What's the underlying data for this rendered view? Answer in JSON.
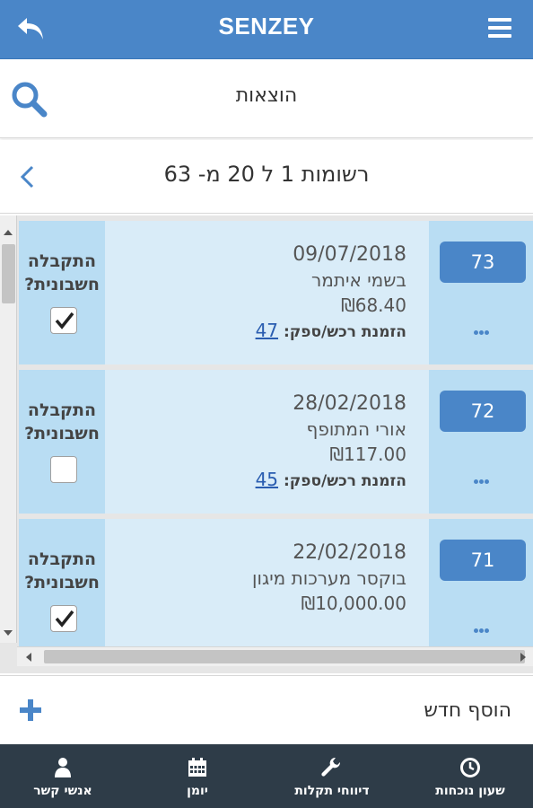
{
  "app": {
    "title": "SENZEY"
  },
  "header": {
    "page_title": "הוצאות"
  },
  "records": {
    "summary": "רשומות 1 ל 20 מ- 63"
  },
  "rows": [
    {
      "number": "73",
      "date": "09/07/2018",
      "supplier": "בשמי איתמר",
      "amount": "₪68.40",
      "order_label": "הזמנת רכש/ספק:",
      "order_link": "47",
      "check_label_line1": "התקבלה",
      "check_label_line2": "חשבונית?",
      "checked": true
    },
    {
      "number": "72",
      "date": "28/02/2018",
      "supplier": "אורי המתופף",
      "amount": "₪117.00",
      "order_label": "הזמנת רכש/ספק:",
      "order_link": "45",
      "check_label_line1": "התקבלה",
      "check_label_line2": "חשבונית?",
      "checked": false
    },
    {
      "number": "71",
      "date": "22/02/2018",
      "supplier": "בוקסר מערכות מיגון",
      "amount": "₪10,000.00",
      "order_label": "",
      "order_link": "",
      "check_label_line1": "התקבלה",
      "check_label_line2": "חשבונית?",
      "checked": true
    }
  ],
  "add_new": {
    "label": "הוסף חדש"
  },
  "nav": [
    {
      "label": "אנשי קשר",
      "icon": "person-icon"
    },
    {
      "label": "יומן",
      "icon": "calendar-icon"
    },
    {
      "label": "דיווחי תקלות",
      "icon": "wrench-icon"
    },
    {
      "label": "שעון נוכחות",
      "icon": "clock-icon"
    }
  ],
  "colors": {
    "primary": "#4a86c8",
    "row_bg": "#d9ecf8",
    "row_side": "#b9ddf3",
    "nav_bg": "#2e3c48"
  }
}
